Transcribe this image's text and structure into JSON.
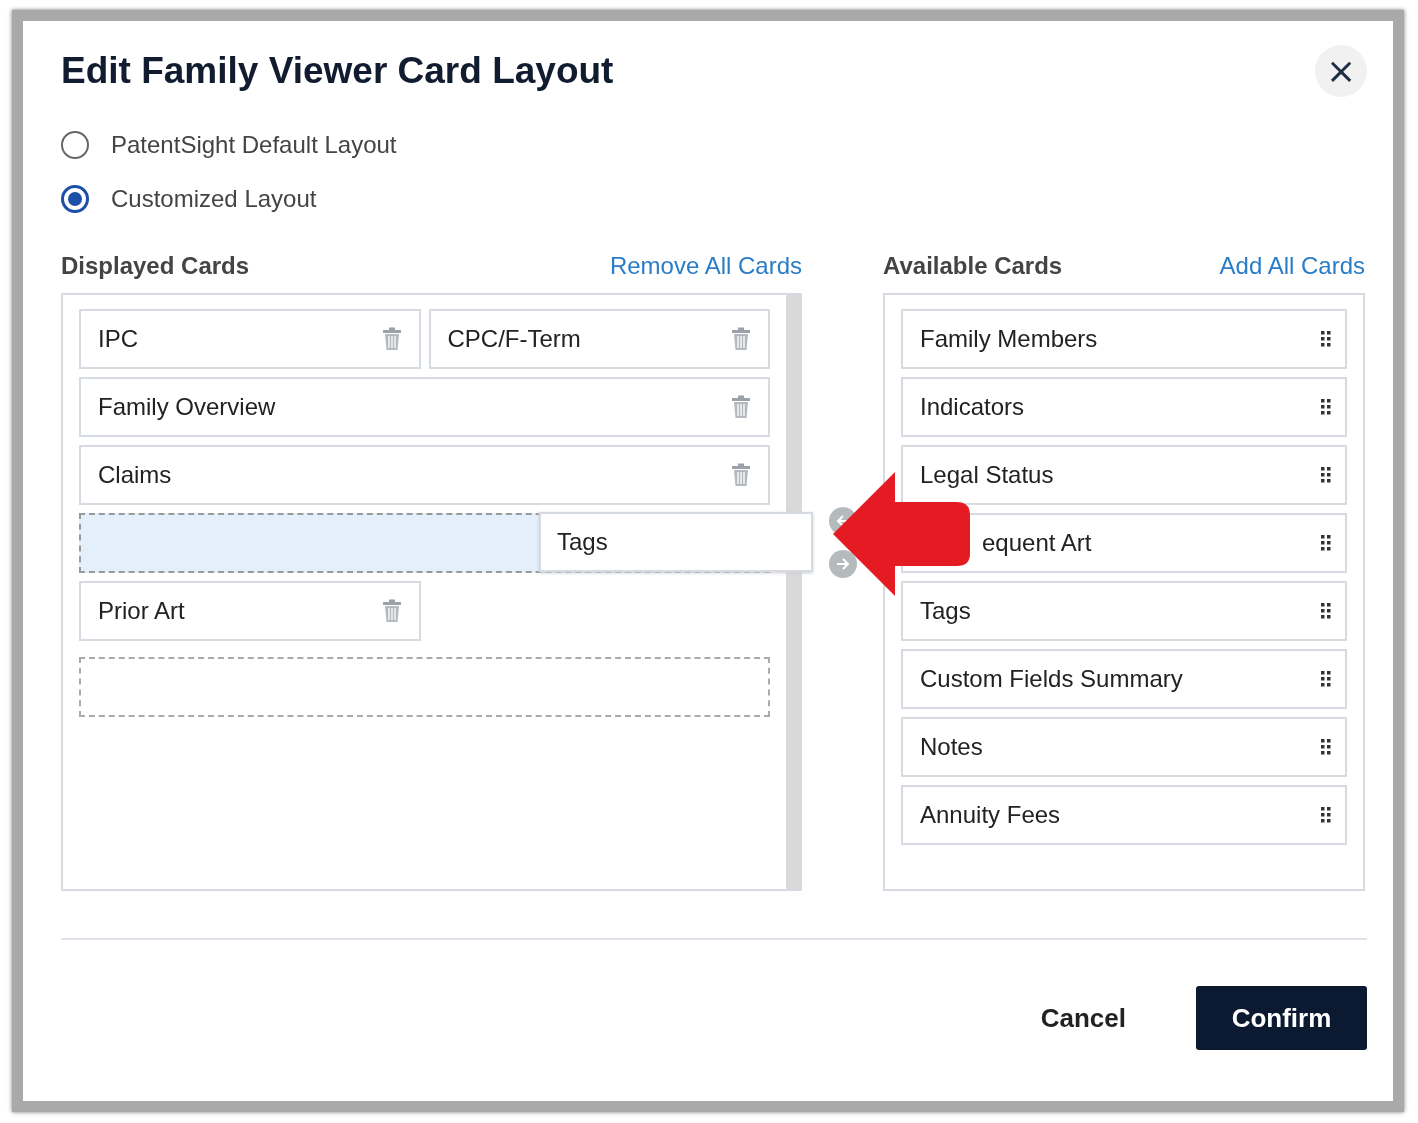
{
  "dialog": {
    "title": "Edit Family Viewer Card Layout",
    "close_label": "×"
  },
  "layout_options": [
    {
      "label": "PatentSight Default Layout",
      "selected": false
    },
    {
      "label": "Customized Layout",
      "selected": true
    }
  ],
  "displayed": {
    "heading": "Displayed Cards",
    "action": "Remove All Cards",
    "cards": [
      {
        "kind": "half_card",
        "label": "IPC"
      },
      {
        "kind": "half_card",
        "label": "CPC/F-Term"
      },
      {
        "kind": "wide_card",
        "label": "Family Overview"
      },
      {
        "kind": "wide_card",
        "label": "Claims"
      },
      {
        "kind": "drop_target"
      },
      {
        "kind": "half_card",
        "label": "Prior Art"
      },
      {
        "kind": "empty_slot"
      }
    ]
  },
  "dragged_card": {
    "label": "Tags"
  },
  "available": {
    "heading": "Available Cards",
    "action": "Add All Cards",
    "cards": [
      {
        "label": "Family Members",
        "covered": false
      },
      {
        "label": "Indicators",
        "covered": false
      },
      {
        "label": "Legal Status",
        "covered": false
      },
      {
        "label": "equent Art",
        "covered": true
      },
      {
        "label": "Tags",
        "covered": false
      },
      {
        "label": "Custom Fields Summary",
        "covered": false
      },
      {
        "label": "Notes",
        "covered": false
      },
      {
        "label": "Annuity Fees",
        "covered": false
      }
    ]
  },
  "buttons": [
    {
      "kind": "secondary",
      "label": "Cancel"
    },
    {
      "kind": "primary",
      "label": "Confirm"
    }
  ]
}
